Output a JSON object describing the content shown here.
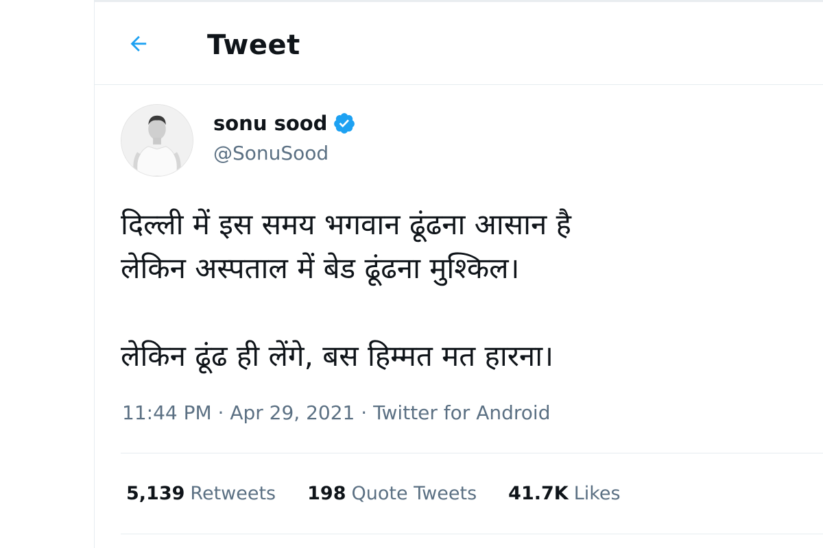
{
  "header": {
    "title": "Tweet",
    "back_icon": "arrow-left-icon"
  },
  "author": {
    "name": "sonu sood",
    "handle": "@SonuSood",
    "verified": true,
    "avatar_icon": "profile-photo"
  },
  "tweet": {
    "lines": [
      "दिल्ली में इस समय भगवान ढूंढना आसान है",
      "लेकिन अस्पताल में बेड ढूंढना मुश्किल।",
      "लेकिन ढूंढ ही लेंगे, बस हिम्मत मत हारना।"
    ]
  },
  "meta": {
    "time_date_source": "11:44 PM · Apr 29, 2021 · Twitter for Android"
  },
  "stats": {
    "retweets": {
      "count": "5,139",
      "label": "Retweets"
    },
    "quote_tweets": {
      "count": "198",
      "label": "Quote Tweets"
    },
    "likes": {
      "count": "41.7K",
      "label": "Likes"
    }
  },
  "colors": {
    "accent": "#1da1f2",
    "secondary_text": "#5b7083",
    "primary_text": "#0f1419",
    "divider": "#e6ecf0"
  }
}
